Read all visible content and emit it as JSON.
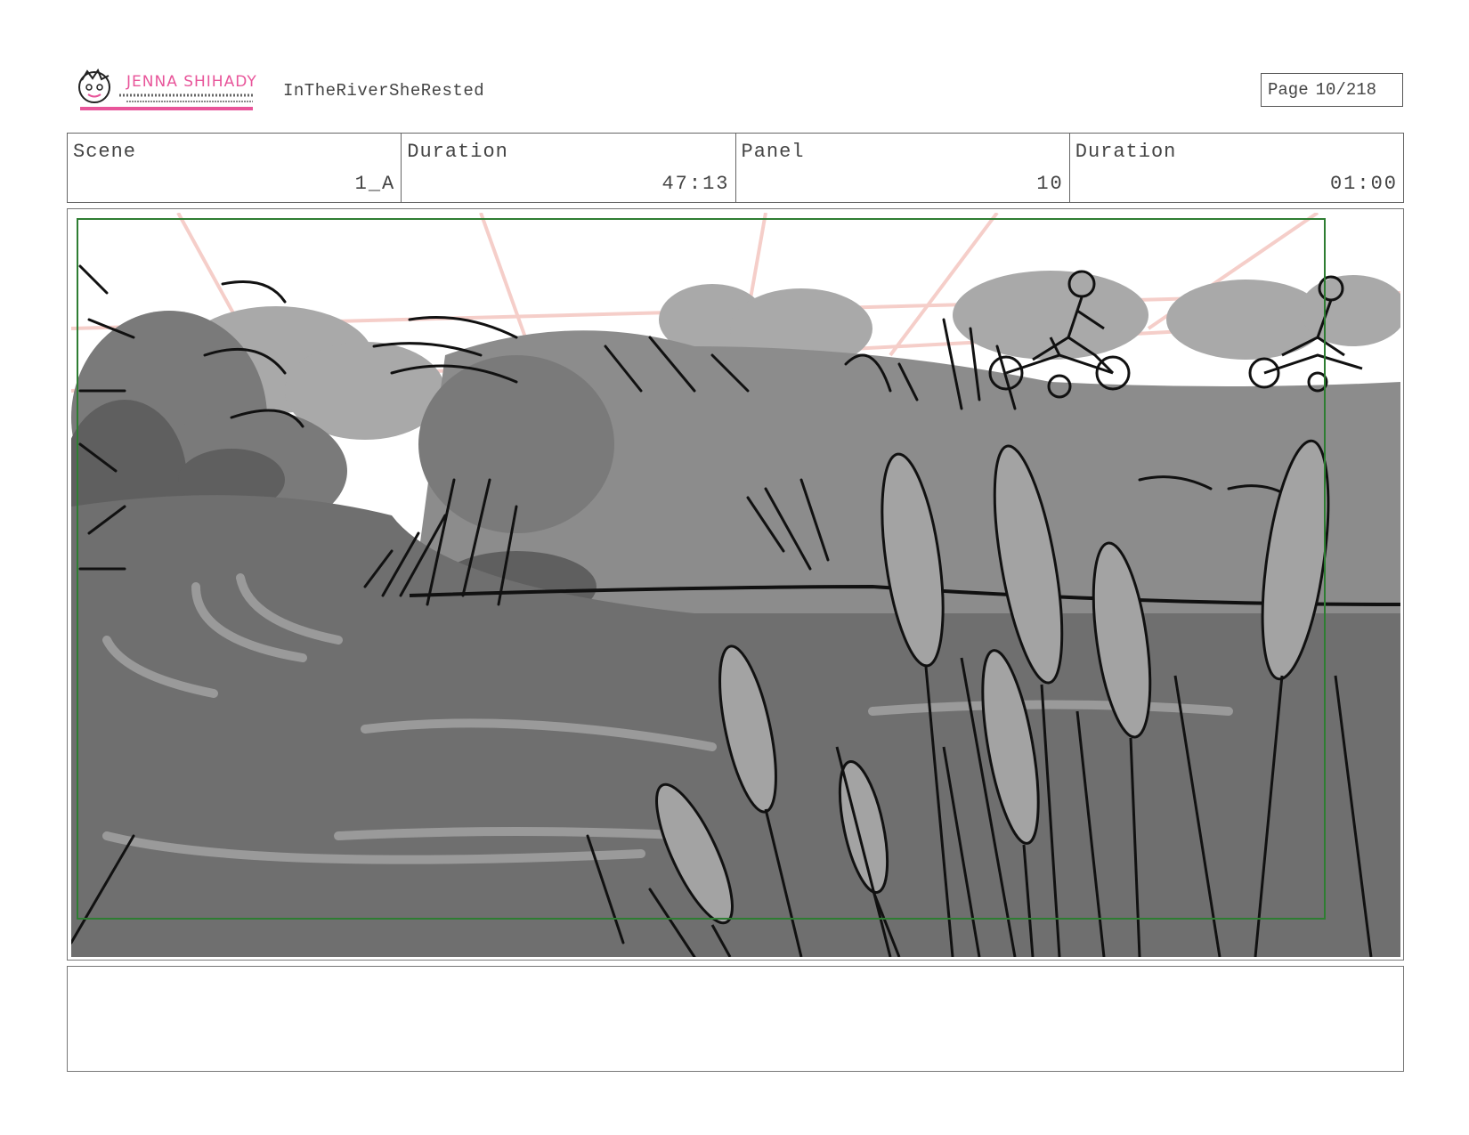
{
  "header": {
    "logo_text": "JENNA SHIHADY",
    "project_name": "InTheRiverSheRested",
    "page_label": "Page",
    "page_number": "10/218"
  },
  "info": {
    "scene_label": "Scene",
    "scene_value": "1_A",
    "scene_duration_label": "Duration",
    "scene_duration_value": "47:13",
    "panel_label": "Panel",
    "panel_value": "10",
    "panel_duration_label": "Duration",
    "panel_duration_value": "01:00"
  },
  "notes": {
    "text": ""
  },
  "colors": {
    "logo_pink": "#e8559a",
    "safe_frame_green": "#2e7d32",
    "perspective_guides": "#f5c9c4"
  }
}
